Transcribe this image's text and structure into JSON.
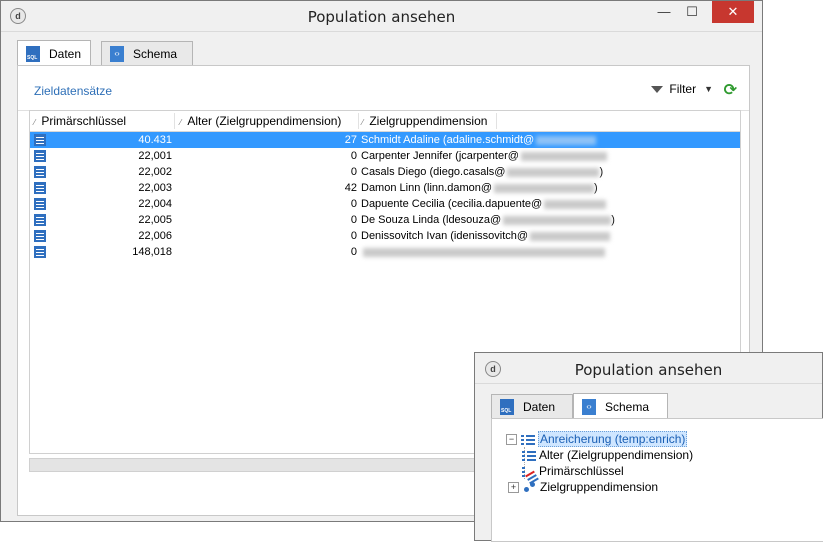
{
  "window1": {
    "title": "Population ansehen",
    "controls": {
      "minimize": "—",
      "maximize": "☐",
      "close": "✕"
    },
    "tabs": [
      {
        "label": "Daten",
        "icon": "sql-icon"
      },
      {
        "label": "Schema",
        "icon": "schema-icon"
      }
    ],
    "section_title": "Zieldatensätze",
    "filter_label": "Filter",
    "columns": [
      "Primärschlüssel",
      "Alter (Zielgruppendimension)",
      "Zielgruppendimension"
    ],
    "rows": [
      {
        "key": "40.431",
        "age": "27",
        "dim": "Schmidt Adaline (adaline.schmidt@"
      },
      {
        "key": "22,001",
        "age": "0",
        "dim": "Carpenter Jennifer (jcarpenter@"
      },
      {
        "key": "22,002",
        "age": "0",
        "dim": "Casals Diego (diego.casals@",
        "suffix": ")"
      },
      {
        "key": "22,003",
        "age": "42",
        "dim": "Damon Linn (linn.damon@",
        "suffix": ")"
      },
      {
        "key": "22,004",
        "age": "0",
        "dim": "Dapuente Cecilia (cecilia.dapuente@"
      },
      {
        "key": "22,005",
        "age": "0",
        "dim": "De Souza Linda (ldesouza@",
        "suffix": ")"
      },
      {
        "key": "22,006",
        "age": "0",
        "dim": "Denissovitch Ivan (idenissovitch@"
      },
      {
        "key": "148,018",
        "age": "0",
        "dim": ""
      }
    ]
  },
  "window2": {
    "title": "Population ansehen",
    "tabs": [
      {
        "label": "Daten",
        "icon": "sql-icon"
      },
      {
        "label": "Schema",
        "icon": "schema-icon"
      }
    ],
    "tree": {
      "root": "Anreicherung (temp:enrich)",
      "root_toggle": "−",
      "children": [
        "Alter (Zielgruppendimension)",
        "Primärschlüssel",
        "Zielgruppendimension"
      ],
      "child_toggle": "+"
    }
  }
}
